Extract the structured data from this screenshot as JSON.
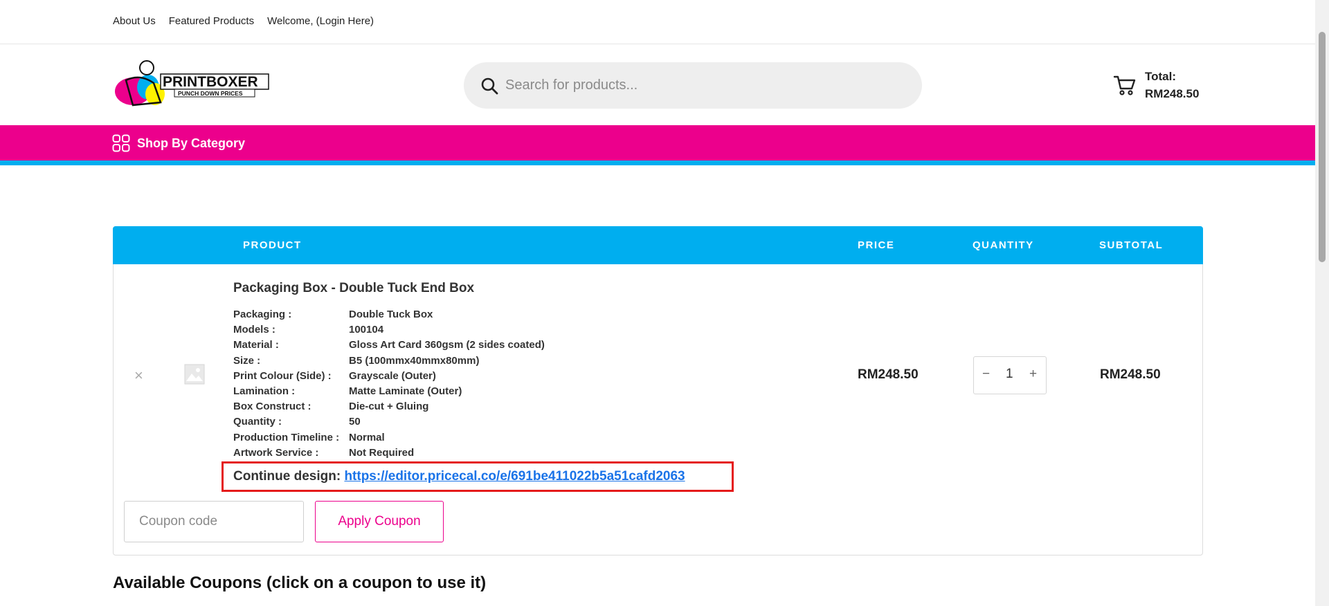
{
  "topnav": {
    "links": [
      "About Us",
      "Featured Products",
      "Welcome, (Login Here)"
    ]
  },
  "brand": {
    "name": "PRINTBOXER",
    "tagline": "PUNCH DOWN PRICES",
    "colors": {
      "magenta": "#ec008c",
      "cyan": "#00aeef",
      "yellow": "#fff200"
    }
  },
  "search": {
    "placeholder": "Search for products...",
    "value": "",
    "icon": "search-icon"
  },
  "cart": {
    "total_label": "Total:",
    "total_value": "RM248.50",
    "icon": "cart-icon"
  },
  "category_nav": {
    "label": "Shop By Category",
    "icon": "grid-icon"
  },
  "table": {
    "headers": {
      "product": "PRODUCT",
      "price": "PRICE",
      "quantity": "QUANTITY",
      "subtotal": "SUBTOTAL"
    }
  },
  "item": {
    "remove_glyph": "×",
    "name": "Packaging Box - Double Tuck End Box",
    "attributes": [
      {
        "label": "Packaging :",
        "value": "Double Tuck Box"
      },
      {
        "label": "Models :",
        "value": "100104"
      },
      {
        "label": "Material :",
        "value": "Gloss Art Card 360gsm (2 sides coated)"
      },
      {
        "label": "Size :",
        "value": "B5 (100mmx40mmx80mm)"
      },
      {
        "label": "Print Colour (Side) :",
        "value": "Grayscale (Outer)"
      },
      {
        "label": "Lamination :",
        "value": "Matte Laminate (Outer)"
      },
      {
        "label": "Box Construct :",
        "value": "Die-cut + Gluing"
      },
      {
        "label": "Quantity :",
        "value": "50"
      },
      {
        "label": "Production Timeline :",
        "value": "Normal"
      },
      {
        "label": "Artwork Service :",
        "value": "Not Required"
      }
    ],
    "design_label": "Continue design:",
    "design_link": "https://editor.pricecal.co/e/691be411022b5a51cafd2063",
    "price": "RM248.50",
    "quantity": "1",
    "qty_minus": "−",
    "qty_plus": "+",
    "subtotal": "RM248.50"
  },
  "coupon": {
    "placeholder": "Coupon code",
    "value": "",
    "apply_label": "Apply Coupon"
  },
  "available_coupons_title": "Available Coupons (click on a coupon to use it)"
}
